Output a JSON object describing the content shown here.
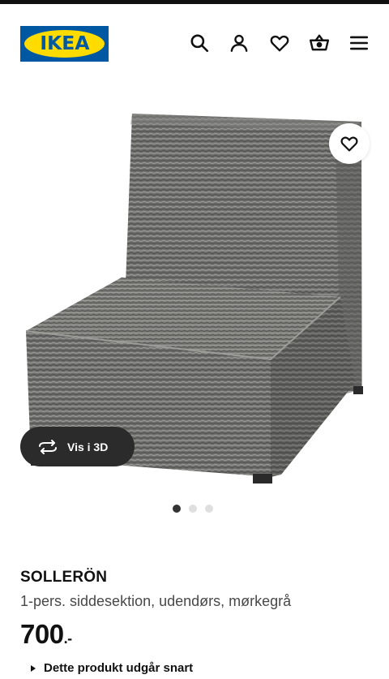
{
  "header": {
    "logo_text": "IKEA",
    "icons": [
      "search-icon",
      "user-icon",
      "heart-icon",
      "basket-icon",
      "menu-icon"
    ]
  },
  "gallery": {
    "view_3d_label": "Vis i 3D",
    "page_count": 3,
    "current_page": 1
  },
  "product": {
    "name": "SOLLERÖN",
    "description": "1-pers. siddesektion, udendørs, mørkegrå",
    "price": "700",
    "price_suffix": ".-",
    "notice": "Dette produkt udgår snart"
  },
  "colors": {
    "brand_blue": "#0058a3",
    "brand_yellow": "#ffdb00",
    "button_dark": "#2b2b2b"
  }
}
